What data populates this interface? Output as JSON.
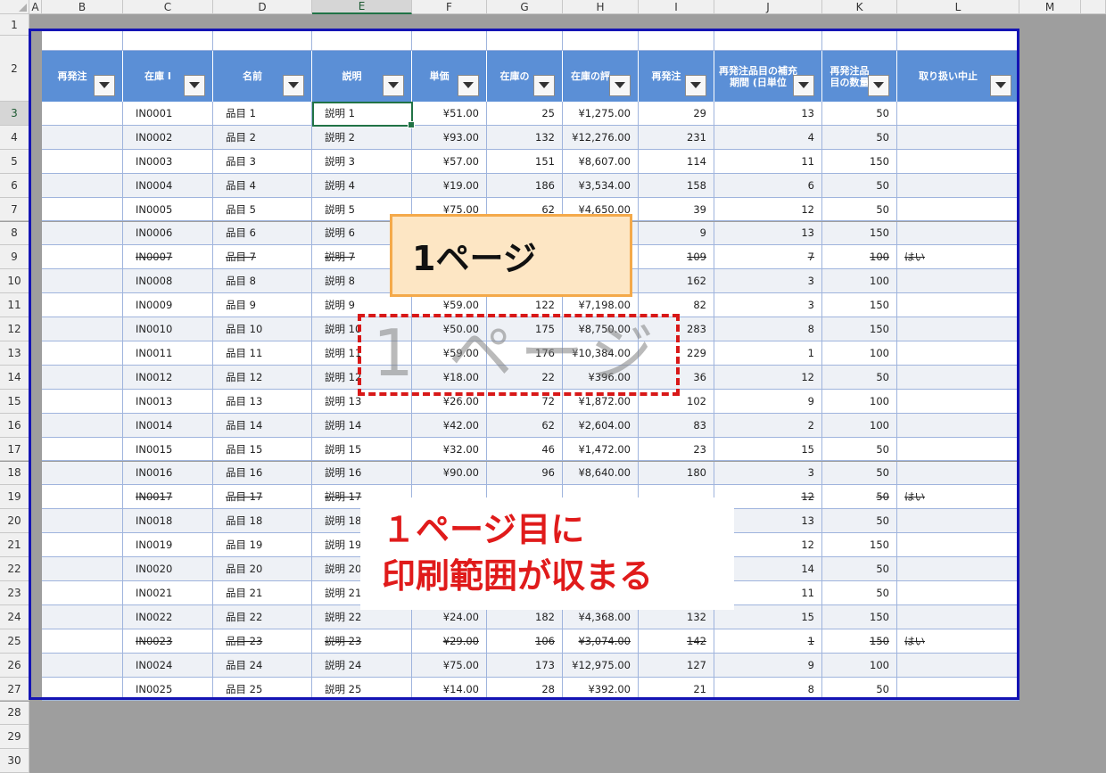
{
  "columns": [
    "A",
    "B",
    "C",
    "D",
    "E",
    "F",
    "G",
    "H",
    "I",
    "J",
    "K",
    "L",
    "M"
  ],
  "selected_column": "E",
  "row_numbers": [
    "1",
    "2",
    "3",
    "4",
    "5",
    "6",
    "7",
    "8",
    "9",
    "10",
    "11",
    "12",
    "13",
    "14",
    "15",
    "16",
    "17",
    "18",
    "19",
    "20",
    "21",
    "22",
    "23",
    "24",
    "25",
    "26",
    "27",
    "28",
    "29",
    "30"
  ],
  "selected_row": "3",
  "headers": [
    "再発注",
    "在庫 I",
    "名前",
    "説明",
    "単価",
    "在庫の",
    "在庫の評",
    "再発注",
    "再発注品目の補充期間 (日単位",
    "再発注品目の数量",
    "取り扱い中止"
  ],
  "rows": [
    {
      "id": "IN0001",
      "name": "品目 1",
      "desc": "説明 1",
      "price": "¥51.00",
      "qty": "25",
      "value": "¥1,275.00",
      "reorder": "29",
      "days": "13",
      "reorder_qty": "50",
      "disc": "",
      "strike": false
    },
    {
      "id": "IN0002",
      "name": "品目 2",
      "desc": "説明 2",
      "price": "¥93.00",
      "qty": "132",
      "value": "¥12,276.00",
      "reorder": "231",
      "days": "4",
      "reorder_qty": "50",
      "disc": "",
      "strike": false
    },
    {
      "id": "IN0003",
      "name": "品目 3",
      "desc": "説明 3",
      "price": "¥57.00",
      "qty": "151",
      "value": "¥8,607.00",
      "reorder": "114",
      "days": "11",
      "reorder_qty": "150",
      "disc": "",
      "strike": false
    },
    {
      "id": "IN0004",
      "name": "品目 4",
      "desc": "説明 4",
      "price": "¥19.00",
      "qty": "186",
      "value": "¥3,534.00",
      "reorder": "158",
      "days": "6",
      "reorder_qty": "50",
      "disc": "",
      "strike": false
    },
    {
      "id": "IN0005",
      "name": "品目 5",
      "desc": "説明 5",
      "price": "¥75.00",
      "qty": "62",
      "value": "¥4,650.00",
      "reorder": "39",
      "days": "12",
      "reorder_qty": "50",
      "disc": "",
      "strike": false
    },
    {
      "id": "IN0006",
      "name": "品目 6",
      "desc": "説明 6",
      "price": "",
      "qty": "",
      "value": "",
      "reorder": "9",
      "days": "13",
      "reorder_qty": "150",
      "disc": "",
      "strike": false
    },
    {
      "id": "IN0007",
      "name": "品目 7",
      "desc": "説明 7",
      "price": "",
      "qty": "",
      "value": "",
      "reorder": "109",
      "days": "7",
      "reorder_qty": "100",
      "disc": "はい",
      "strike": true
    },
    {
      "id": "IN0008",
      "name": "品目 8",
      "desc": "説明 8",
      "price": "",
      "qty": "",
      "value": "",
      "reorder": "162",
      "days": "3",
      "reorder_qty": "100",
      "disc": "",
      "strike": false
    },
    {
      "id": "IN0009",
      "name": "品目 9",
      "desc": "説明 9",
      "price": "¥59.00",
      "qty": "122",
      "value": "¥7,198.00",
      "reorder": "82",
      "days": "3",
      "reorder_qty": "150",
      "disc": "",
      "strike": false
    },
    {
      "id": "IN0010",
      "name": "品目 10",
      "desc": "説明 10",
      "price": "¥50.00",
      "qty": "175",
      "value": "¥8,750.00",
      "reorder": "283",
      "days": "8",
      "reorder_qty": "150",
      "disc": "",
      "strike": false
    },
    {
      "id": "IN0011",
      "name": "品目 11",
      "desc": "説明 11",
      "price": "¥59.00",
      "qty": "176",
      "value": "¥10,384.00",
      "reorder": "229",
      "days": "1",
      "reorder_qty": "100",
      "disc": "",
      "strike": false
    },
    {
      "id": "IN0012",
      "name": "品目 12",
      "desc": "説明 12",
      "price": "¥18.00",
      "qty": "22",
      "value": "¥396.00",
      "reorder": "36",
      "days": "12",
      "reorder_qty": "50",
      "disc": "",
      "strike": false
    },
    {
      "id": "IN0013",
      "name": "品目 13",
      "desc": "説明 13",
      "price": "¥26.00",
      "qty": "72",
      "value": "¥1,872.00",
      "reorder": "102",
      "days": "9",
      "reorder_qty": "100",
      "disc": "",
      "strike": false
    },
    {
      "id": "IN0014",
      "name": "品目 14",
      "desc": "説明 14",
      "price": "¥42.00",
      "qty": "62",
      "value": "¥2,604.00",
      "reorder": "83",
      "days": "2",
      "reorder_qty": "100",
      "disc": "",
      "strike": false
    },
    {
      "id": "IN0015",
      "name": "品目 15",
      "desc": "説明 15",
      "price": "¥32.00",
      "qty": "46",
      "value": "¥1,472.00",
      "reorder": "23",
      "days": "15",
      "reorder_qty": "50",
      "disc": "",
      "strike": false
    },
    {
      "id": "IN0016",
      "name": "品目 16",
      "desc": "説明 16",
      "price": "¥90.00",
      "qty": "96",
      "value": "¥8,640.00",
      "reorder": "180",
      "days": "3",
      "reorder_qty": "50",
      "disc": "",
      "strike": false
    },
    {
      "id": "IN0017",
      "name": "品目 17",
      "desc": "説明 17",
      "price": "",
      "qty": "",
      "value": "",
      "reorder": "",
      "days": "12",
      "reorder_qty": "50",
      "disc": "はい",
      "strike": true
    },
    {
      "id": "IN0018",
      "name": "品目 18",
      "desc": "説明 18",
      "price": "",
      "qty": "",
      "value": "",
      "reorder": "",
      "days": "13",
      "reorder_qty": "50",
      "disc": "",
      "strike": false
    },
    {
      "id": "IN0019",
      "name": "品目 19",
      "desc": "説明 19",
      "price": "",
      "qty": "",
      "value": "",
      "reorder": "",
      "days": "12",
      "reorder_qty": "150",
      "disc": "",
      "strike": false
    },
    {
      "id": "IN0020",
      "name": "品目 20",
      "desc": "説明 20",
      "price": "",
      "qty": "",
      "value": "",
      "reorder": "",
      "days": "14",
      "reorder_qty": "50",
      "disc": "",
      "strike": false
    },
    {
      "id": "IN0021",
      "name": "品目 21",
      "desc": "説明 21",
      "price": "",
      "qty": "",
      "value": "",
      "reorder": "",
      "days": "11",
      "reorder_qty": "50",
      "disc": "",
      "strike": false
    },
    {
      "id": "IN0022",
      "name": "品目 22",
      "desc": "説明 22",
      "price": "¥24.00",
      "qty": "182",
      "value": "¥4,368.00",
      "reorder": "132",
      "days": "15",
      "reorder_qty": "150",
      "disc": "",
      "strike": false
    },
    {
      "id": "IN0023",
      "name": "品目 23",
      "desc": "説明 23",
      "price": "¥29.00",
      "qty": "106",
      "value": "¥3,074.00",
      "reorder": "142",
      "days": "1",
      "reorder_qty": "150",
      "disc": "はい",
      "strike": true
    },
    {
      "id": "IN0024",
      "name": "品目 24",
      "desc": "説明 24",
      "price": "¥75.00",
      "qty": "173",
      "value": "¥12,975.00",
      "reorder": "127",
      "days": "9",
      "reorder_qty": "100",
      "disc": "",
      "strike": false
    },
    {
      "id": "IN0025",
      "name": "品目 25",
      "desc": "説明 25",
      "price": "¥14.00",
      "qty": "28",
      "value": "¥392.00",
      "reorder": "21",
      "days": "8",
      "reorder_qty": "50",
      "disc": "",
      "strike": false
    }
  ],
  "callouts": {
    "page_label": "1ページ",
    "watermark": "1 ページ",
    "note_line1": "１ページ目に",
    "note_line2": "印刷範囲が収まる"
  },
  "colors": {
    "header_bg": "#5b8fd6",
    "table_border": "#1414b4",
    "callout_red": "#e01b1b",
    "callout_orange": "#f4a94a"
  }
}
